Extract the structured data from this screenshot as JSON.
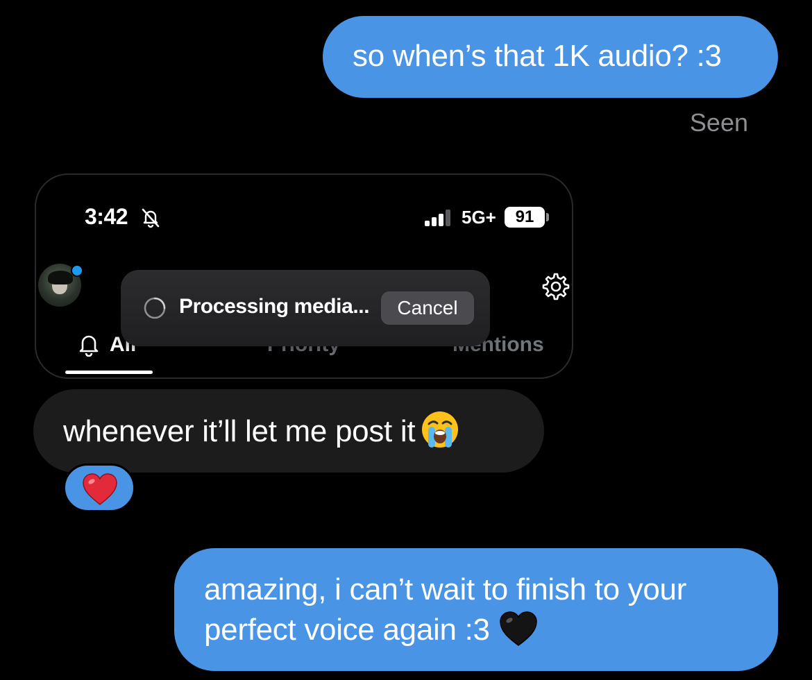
{
  "messages": [
    {
      "id": "msg1",
      "direction": "sent",
      "text": "so when’s that 1K audio? :3"
    },
    {
      "id": "msg2",
      "direction": "received",
      "text": "whenever it’ll let me post it",
      "emoji": "loudly-crying-face"
    },
    {
      "id": "msg3",
      "direction": "sent",
      "lines": [
        "amazing, i can’t wait to finish to your",
        "perfect voice again :3"
      ],
      "emoji": "black-heart"
    }
  ],
  "receipt": "Seen",
  "reaction": {
    "emoji": "red-heart",
    "on_message": "msg2"
  },
  "screenshot": {
    "status_bar": {
      "time": "3:42",
      "silent_icon": "bell-slash-icon",
      "signal_icon": "signal-bars-icon",
      "network": "5G+",
      "battery": "91"
    },
    "toast": {
      "text": "Processing media...",
      "cancel_label": "Cancel",
      "spinner_icon": "spinner-icon"
    },
    "tabs": [
      {
        "label": "All",
        "icon": "bell-icon",
        "selected": true
      },
      {
        "label": "Priority",
        "selected": false
      },
      {
        "label": "Mentions",
        "selected": false
      }
    ],
    "settings_icon": "gear-icon"
  },
  "colors": {
    "background": "#000000",
    "sent_bubble": "#4a94e6",
    "received_bubble": "#1c1c1d",
    "receipt_text": "#8e8e93",
    "accent_dot": "#1d9bf0"
  }
}
